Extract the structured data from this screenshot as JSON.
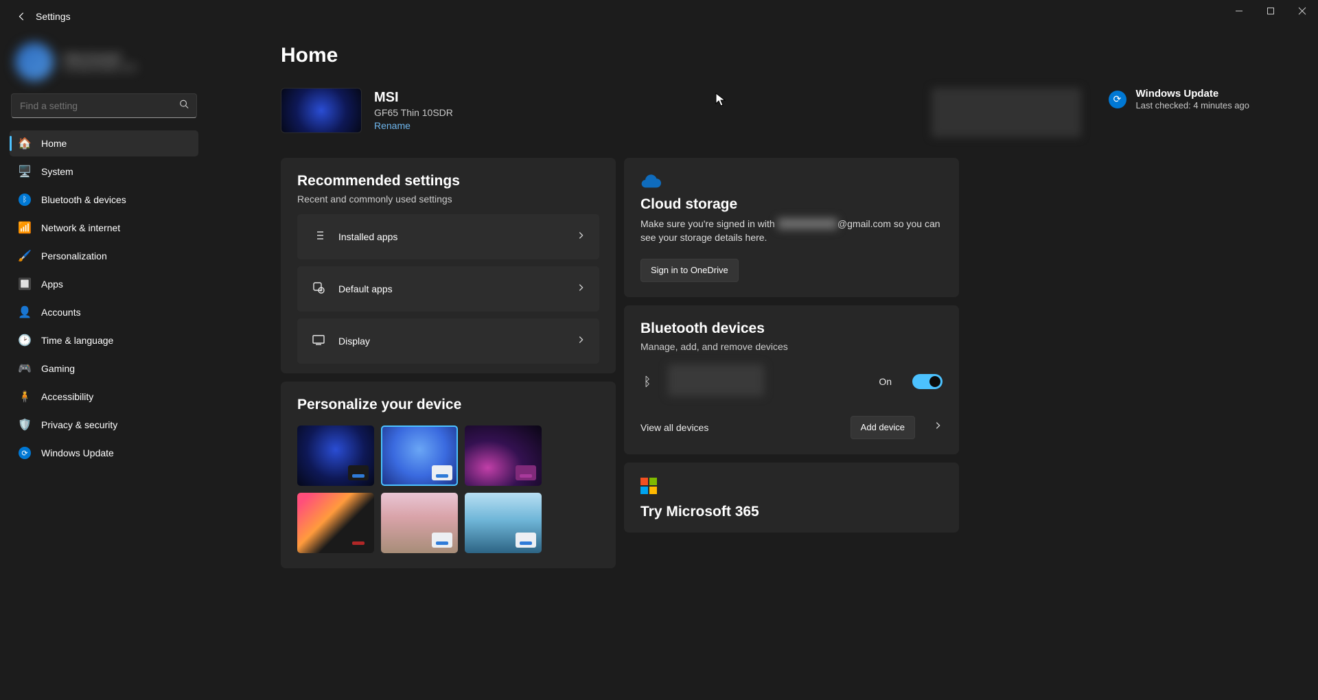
{
  "app": {
    "title": "Settings"
  },
  "search": {
    "placeholder": "Find a setting"
  },
  "user": {
    "name": "User Account",
    "email": "user@example.com"
  },
  "sidebar": {
    "items": [
      {
        "label": "Home"
      },
      {
        "label": "System"
      },
      {
        "label": "Bluetooth & devices"
      },
      {
        "label": "Network & internet"
      },
      {
        "label": "Personalization"
      },
      {
        "label": "Apps"
      },
      {
        "label": "Accounts"
      },
      {
        "label": "Time & language"
      },
      {
        "label": "Gaming"
      },
      {
        "label": "Accessibility"
      },
      {
        "label": "Privacy & security"
      },
      {
        "label": "Windows Update"
      }
    ]
  },
  "page": {
    "title": "Home"
  },
  "device": {
    "name": "MSI",
    "model": "GF65 Thin 10SDR",
    "rename": "Rename"
  },
  "update": {
    "title": "Windows Update",
    "subtitle": "Last checked: 4 minutes ago"
  },
  "recommended": {
    "title": "Recommended settings",
    "subtitle": "Recent and commonly used settings",
    "items": [
      {
        "label": "Installed apps"
      },
      {
        "label": "Default apps"
      },
      {
        "label": "Display"
      }
    ]
  },
  "personalize": {
    "title": "Personalize your device"
  },
  "cloud": {
    "title": "Cloud storage",
    "desc_prefix": "Make sure you're signed in with ",
    "email_masked": "████████",
    "email_suffix": "@gmail.com",
    "desc_suffix": " so you can see your storage details here.",
    "button": "Sign in to OneDrive"
  },
  "bluetooth": {
    "title": "Bluetooth devices",
    "subtitle": "Manage, add, and remove devices",
    "state_label": "On",
    "view_all": "View all devices",
    "add_device": "Add device"
  },
  "m365": {
    "title": "Try Microsoft 365"
  }
}
